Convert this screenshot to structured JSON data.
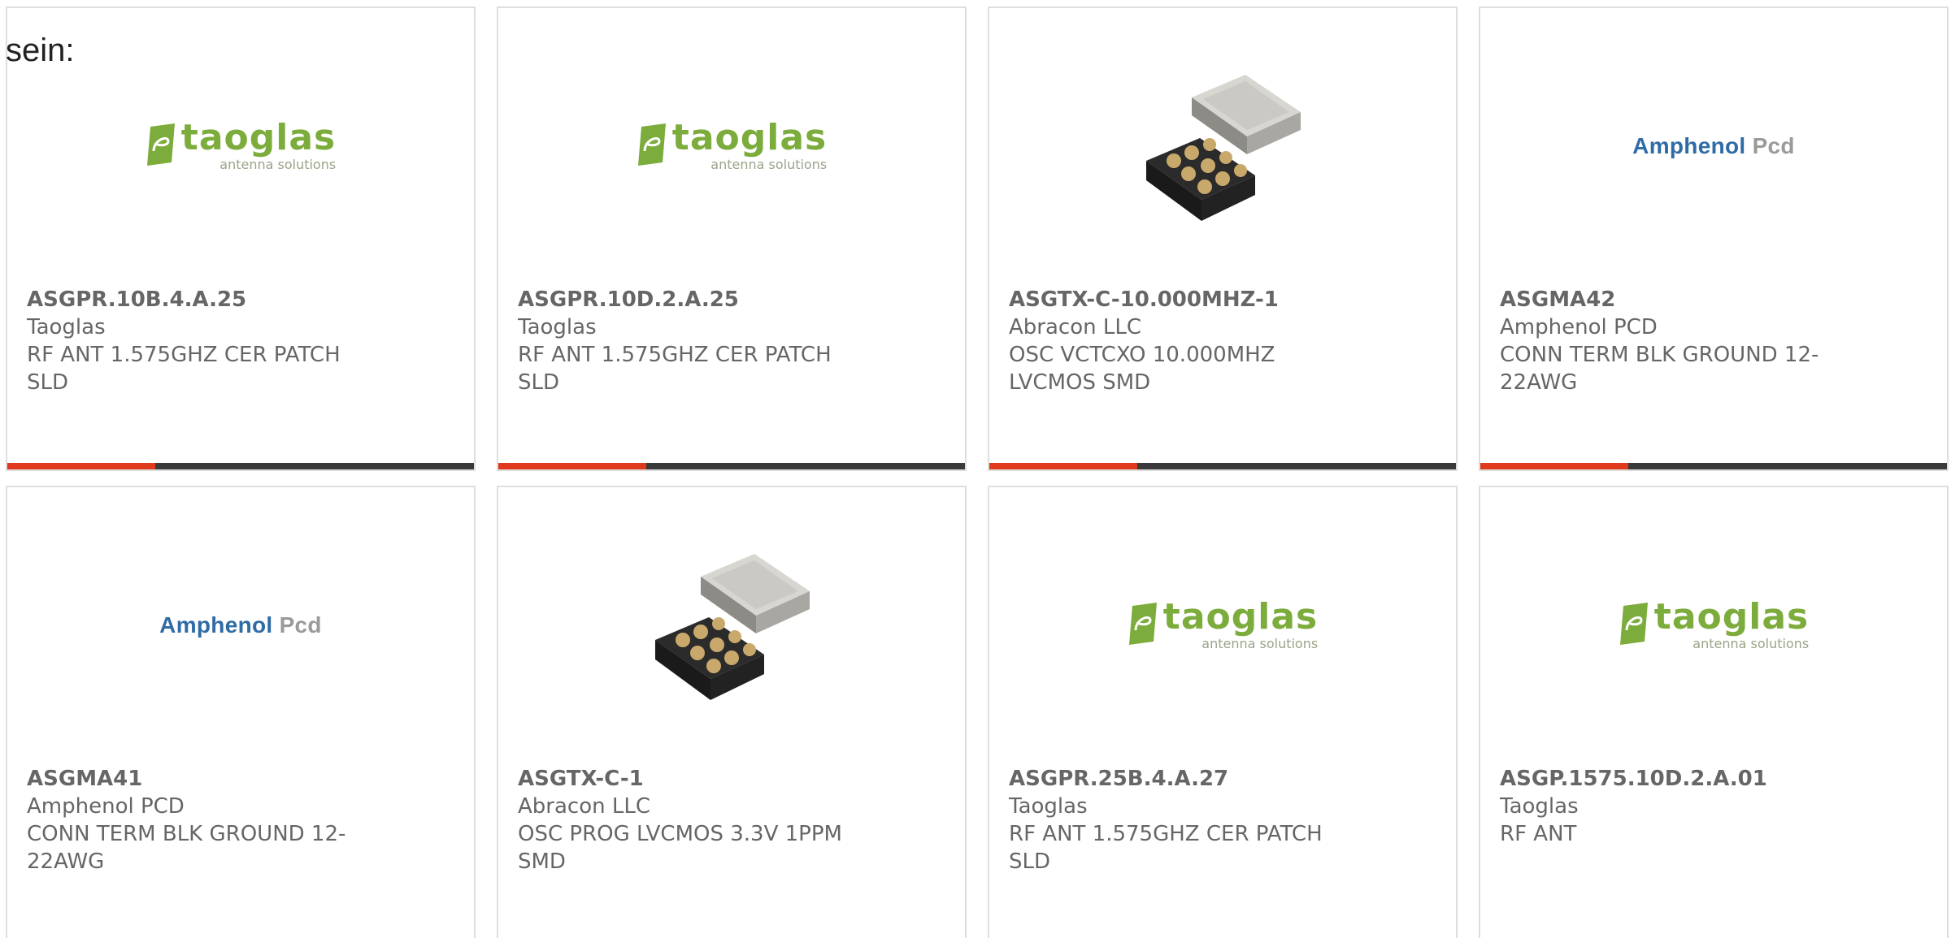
{
  "intro_text": "sein:",
  "colors": {
    "accent_bar": "#e03a1e",
    "bar_dark": "#3a3a3a",
    "taoglas_green": "#7cac3b",
    "amphenol_blue": "#2f6ba5",
    "card_border": "#dedede",
    "text_gray": "#666666"
  },
  "logos": {
    "taoglas": {
      "word": "taoglas",
      "sub": "antenna solutions"
    },
    "amphenol": {
      "part1": "Amphenol",
      "part2": "Pcd"
    }
  },
  "products": [
    {
      "part_number": "ASGPR.10B.4.A.25",
      "manufacturer": "Taoglas",
      "description": "RF ANT 1.575GHZ CER PATCH SLD",
      "image": "taoglas-logo"
    },
    {
      "part_number": "ASGPR.10D.2.A.25",
      "manufacturer": "Taoglas",
      "description": "RF ANT 1.575GHZ CER PATCH SLD",
      "image": "taoglas-logo"
    },
    {
      "part_number": "ASGTX-C-10.000MHZ-1",
      "manufacturer": "Abracon LLC",
      "description": "OSC VCTCXO 10.000MHZ LVCMOS SMD",
      "image": "oscillator-chip"
    },
    {
      "part_number": "ASGMA42",
      "manufacturer": "Amphenol PCD",
      "description": "CONN TERM BLK GROUND 12-22AWG",
      "image": "amphenol-logo"
    },
    {
      "part_number": "ASGMA41",
      "manufacturer": "Amphenol PCD",
      "description": "CONN TERM BLK GROUND 12-22AWG",
      "image": "amphenol-logo"
    },
    {
      "part_number": "ASGTX-C-1",
      "manufacturer": "Abracon LLC",
      "description": "OSC PROG LVCMOS 3.3V 1PPM SMD",
      "image": "oscillator-chip"
    },
    {
      "part_number": "ASGPR.25B.4.A.27",
      "manufacturer": "Taoglas",
      "description": "RF ANT 1.575GHZ CER PATCH SLD",
      "image": "taoglas-logo"
    },
    {
      "part_number": "ASGP.1575.10D.2.A.01",
      "manufacturer": "Taoglas",
      "description": "RF ANT",
      "image": "taoglas-logo"
    }
  ]
}
